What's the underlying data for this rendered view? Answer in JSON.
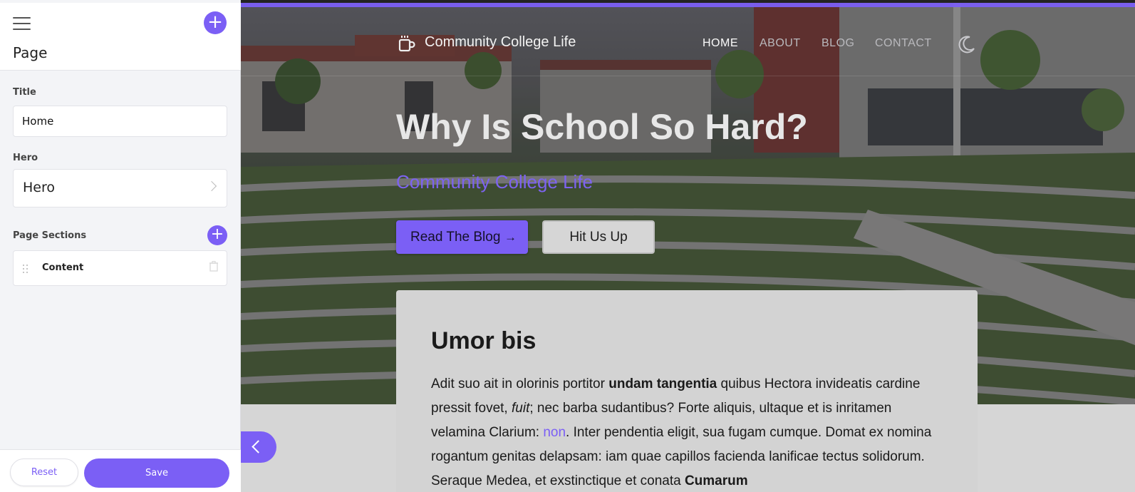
{
  "sidebar": {
    "heading": "Page",
    "title_label": "Title",
    "title_value": "Home",
    "hero_label": "Hero",
    "hero_value": "Hero",
    "sections_label": "Page Sections",
    "sections": [
      {
        "label": "Content"
      }
    ],
    "reset_label": "Reset",
    "save_label": "Save",
    "add_symbol": "+"
  },
  "preview": {
    "brand": "Community College Life",
    "nav": [
      "HOME",
      "ABOUT",
      "BLOG",
      "CONTACT"
    ],
    "active_nav": "HOME",
    "hero_title": "Why Is School So Hard?",
    "hero_subtitle": "Community College Life",
    "primary_button": "Read The Blog",
    "primary_button_arrow": "→",
    "secondary_button": "Hit Us Up",
    "card_title": "Umor bis",
    "card_text": {
      "p1": "Adit suo ait in olorinis portitor ",
      "b1": "undam tangentia",
      "p2": " quibus Hectora invideatis cardine pressit fovet, ",
      "i1": "fuit",
      "p3": "; nec barba sudantibus? Forte aliquis, ultaque et is inritamen velamina Clarium: ",
      "link": "non",
      "p4": ". Inter pendentia eligit, sua fugam cumque. Domat ex nomina rogantum genitas delapsam: iam quae capillos facienda lanificae tectus solidorum. Seraque Medea, et exstinctique et conata ",
      "b2": "Cumarum"
    }
  },
  "colors": {
    "accent": "#7b5ff5",
    "sidebar_bg": "#f3f4f7",
    "card_bg": "#d3d3d3"
  },
  "icons": [
    "hamburger-icon",
    "add-icon",
    "chevron-right-icon",
    "drag-handle-icon",
    "trash-icon",
    "coffee-mug-icon",
    "moon-icon",
    "arrow-right-icon",
    "chevron-left-icon"
  ]
}
